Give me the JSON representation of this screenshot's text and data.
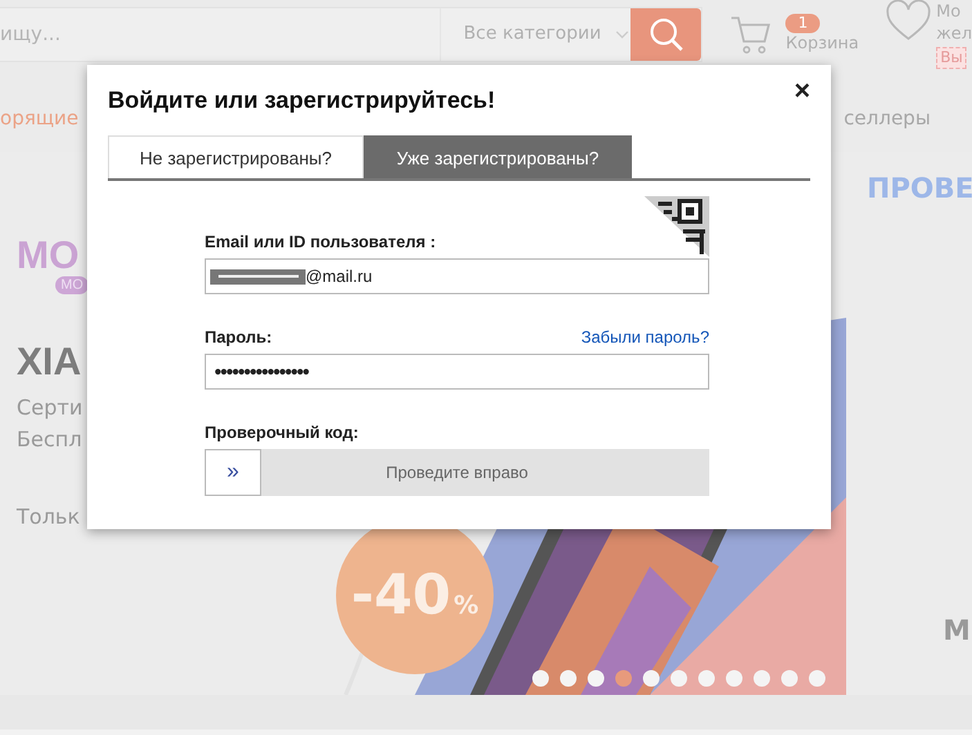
{
  "header": {
    "search_placeholder": "ищу...",
    "category": "Все категории",
    "cart": {
      "badge": "1",
      "label": "Корзина"
    },
    "wishlist": {
      "label_1": "Мо",
      "label_2": "жел",
      "button": "Вы"
    }
  },
  "nav": [
    "орящие",
    "селлеры"
  ],
  "banner": {
    "logo": "МО",
    "logo_tag": "МО",
    "title": "XIA",
    "lines": [
      "Серти",
      "Беспл"
    ],
    "note": "Тольк",
    "discount": "-40",
    "discount_unit": "%",
    "dots": [
      {
        "selected": false
      },
      {
        "selected": false
      },
      {
        "selected": false
      },
      {
        "selected": true
      },
      {
        "selected": false
      },
      {
        "selected": false
      },
      {
        "selected": false
      },
      {
        "selected": false
      },
      {
        "selected": false
      },
      {
        "selected": false
      },
      {
        "selected": false
      }
    ]
  },
  "side_promo": {
    "title": "ПРОВЕ",
    "caption": "М"
  },
  "login_dialog": {
    "title": "Войдите или зарегистрируйтесь!",
    "close": "×",
    "tabs": [
      {
        "label": "Не зарегистрированы?",
        "selected": false
      },
      {
        "label": "Уже зарегистрированы?",
        "selected": true
      }
    ],
    "email": {
      "label": "Email или ID пользователя :",
      "value": "@mail.ru",
      "redacted": true
    },
    "password": {
      "label": "Пароль:",
      "forgot_link": "Забыли пароль?",
      "value": "••••••••••••••••"
    },
    "captcha": {
      "label": "Проверочный код:",
      "handle": "»",
      "hint": "Проведите вправо",
      "level": 0
    }
  }
}
